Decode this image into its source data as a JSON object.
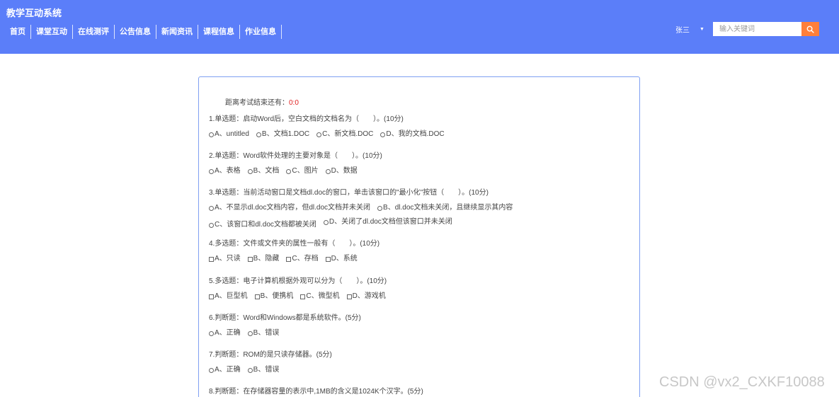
{
  "app": {
    "title": "教学互动系统"
  },
  "nav": {
    "items": [
      "首页",
      "课堂互动",
      "在线测评",
      "公告信息",
      "新闻资讯",
      "课程信息",
      "作业信息"
    ]
  },
  "user": {
    "name": "张三",
    "caret": "▼"
  },
  "search": {
    "placeholder": "输入关键词",
    "button_icon": "search-icon"
  },
  "exam": {
    "timer_label": "距离考试结束还有：",
    "timer_value": "0:0",
    "questions": [
      {
        "title": "1.单选题：启动Word后，空白文档的文档名为（　　）。(10分)",
        "input": "radio",
        "options": [
          "A、untitled",
          "B、文档1.DOC",
          "C、新文档.DOC",
          "D、我的文档.DOC"
        ]
      },
      {
        "title": "2.单选题：Word软件处理的主要对象是（　　）。(10分)",
        "input": "radio",
        "options": [
          "A、表格",
          "B、文档",
          "C、图片",
          "D、数据"
        ]
      },
      {
        "title": "3.单选题：当前活动窗口是文档dl.doc的窗口，单击该窗口的\"最小化\"按钮（　　）。(10分)",
        "input": "radio",
        "options": [
          "A、不显示dl.doc文档内容，但dl.doc文档并未关闭",
          "B、dl.doc文档未关闭，且继续显示其内容",
          "C、该窗口和dl.doc文档都被关闭",
          "D、关闭了dl.doc文档但该窗口并未关闭"
        ]
      },
      {
        "title": "4.多选题：文件或文件夹的属性一般有（　　）。(10分)",
        "input": "checkbox",
        "options": [
          "A、只读",
          "B、隐藏",
          "C、存档",
          "D、系统"
        ]
      },
      {
        "title": "5.多选题：电子计算机根据外观可以分为（　　）。(10分)",
        "input": "checkbox",
        "options": [
          "A、巨型机",
          "B、便携机",
          "C、微型机",
          "D、游戏机"
        ]
      },
      {
        "title": "6.判断题：Word和Windows都是系统软件。(5分)",
        "input": "radio",
        "options": [
          "A、正确",
          "B、错误"
        ]
      },
      {
        "title": "7.判断题：ROM的是只读存储器。(5分)",
        "input": "radio",
        "options": [
          "A、正确",
          "B、错误"
        ]
      },
      {
        "title": "8.判断题：在存储器容量的表示中,1MB的含义是1024K个汉字。(5分)",
        "input": "radio",
        "options": []
      }
    ]
  },
  "watermark": "CSDN @vx2_CXKF10088"
}
